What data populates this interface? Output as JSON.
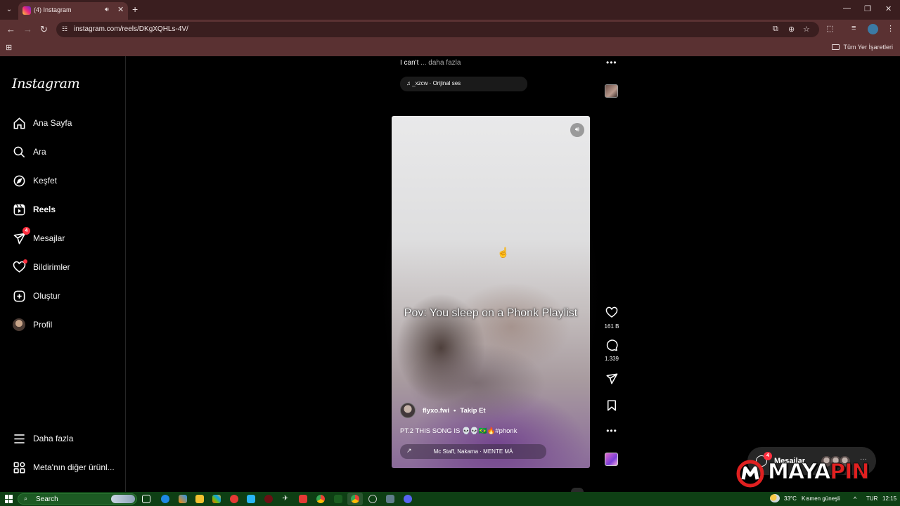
{
  "browser": {
    "tab_title": "(4) Instagram",
    "url": "instagram.com/reels/DKgXQHLs-4V/",
    "all_bookmarks": "Tüm Yer İşaretleri",
    "tab_close": "✕",
    "new_tab": "+",
    "win_minimize": "—",
    "win_restore": "❐",
    "win_close": "✕"
  },
  "sidebar": {
    "logo": "Instagram",
    "items": [
      {
        "label": "Ana Sayfa",
        "icon": "home-icon"
      },
      {
        "label": "Ara",
        "icon": "search-icon"
      },
      {
        "label": "Keşfet",
        "icon": "compass-icon"
      },
      {
        "label": "Reels",
        "icon": "reels-icon"
      },
      {
        "label": "Mesajlar",
        "icon": "messenger-icon",
        "badge": "4"
      },
      {
        "label": "Bildirimler",
        "icon": "heart-icon"
      },
      {
        "label": "Oluştur",
        "icon": "plus-square-icon"
      },
      {
        "label": "Profil",
        "icon": "avatar"
      },
      {
        "label": "Daha fazla",
        "icon": "menu-icon"
      },
      {
        "label": "Meta'nın diğer ürünl...",
        "icon": "grid-icon"
      }
    ]
  },
  "previous_reel": {
    "caption": "I can't",
    "more": "... daha fazla",
    "audio": "_xzcw · Orijinal ses"
  },
  "reel": {
    "overlay_text": "Pov: You sleep on a Phonk Playlist",
    "author": "flyxo.fwi",
    "separator": "•",
    "follow": "Takip Et",
    "caption": "PT.2 THIS SONG IS 💀💀🇧🇷🔥#phonk",
    "audio": "Mc Staff, Nakama · MENTE MÁ",
    "likes": "161 B",
    "comments": "1.339"
  },
  "messages_pill": {
    "label": "Mesajlar",
    "badge": "4",
    "more": "···"
  },
  "watermark": {
    "part1": "MAYA",
    "part2": "PIN"
  },
  "taskbar": {
    "search": "Search",
    "weather": "33°C",
    "weather_desc": "Kısmen güneşli",
    "lang": "TUR",
    "time": "12:15"
  },
  "colors": {
    "chrome_dark": "#3a1e1f",
    "chrome": "#5a3132",
    "instagram_bg": "#000000",
    "notification_red": "#ff3040",
    "taskbar": "#0e3f14"
  }
}
